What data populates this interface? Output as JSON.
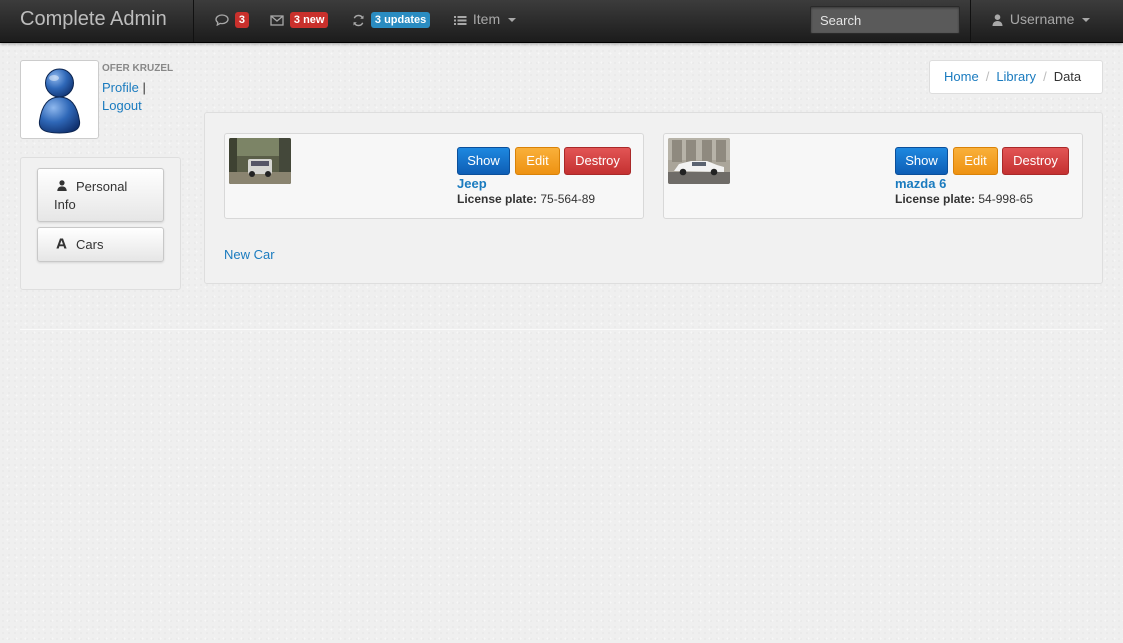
{
  "navbar": {
    "brand": "Complete Admin",
    "messages": {
      "icon": "comment-icon",
      "badge": "3"
    },
    "mail": {
      "icon": "envelope-icon",
      "badge": "3 new"
    },
    "updates": {
      "icon": "refresh-icon",
      "badge": "3 updates"
    },
    "item": {
      "icon": "list-icon",
      "label": "Item"
    },
    "search": {
      "placeholder": "Search"
    },
    "user": {
      "icon": "user-icon",
      "label": "Username"
    }
  },
  "profile": {
    "name": "OFER KRUZEL",
    "profile_link": "Profile",
    "separator": "|",
    "logout_link": "Logout"
  },
  "sidebar": {
    "items": [
      {
        "icon": "user-icon",
        "label_line1": "Personal",
        "label_line2": "Info"
      },
      {
        "icon": "font-icon",
        "label": "Cars"
      }
    ]
  },
  "breadcrumb": {
    "items": [
      "Home",
      "Library"
    ],
    "active": "Data",
    "separator": "/"
  },
  "cars": [
    {
      "name": "Jeep",
      "plate_label": "License plate:",
      "plate": "75-564-89",
      "buttons": {
        "show": "Show",
        "edit": "Edit",
        "destroy": "Destroy"
      }
    },
    {
      "name": "mazda 6",
      "plate_label": "License plate:",
      "plate": "54-998-65",
      "buttons": {
        "show": "Show",
        "edit": "Edit",
        "destroy": "Destroy"
      }
    }
  ],
  "new_car_link": "New Car",
  "colors": {
    "link": "#1a7bbf",
    "badge_red": "#c9302c",
    "badge_blue": "#2a8cc1",
    "btn_show": "#1565c0",
    "btn_edit": "#f0a020",
    "btn_destroy": "#d03c3c"
  }
}
